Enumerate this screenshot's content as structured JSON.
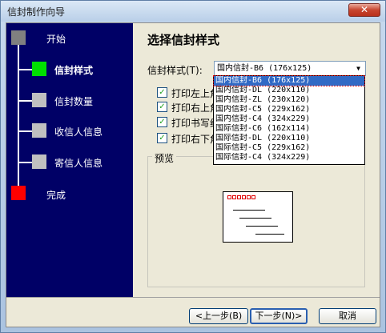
{
  "window": {
    "title": "信封制作向导",
    "close_label": "✕"
  },
  "colors": {
    "sidebar_bg": "#000066",
    "step_done": "#808080",
    "step_active": "#00e000",
    "step_pending": "#c0c0c0",
    "step_finish": "#ff0000",
    "selection": "#316ac5"
  },
  "sidebar": {
    "steps": [
      {
        "label": "开始",
        "state": "done"
      },
      {
        "label": "信封样式",
        "state": "active"
      },
      {
        "label": "信封数量",
        "state": "pending"
      },
      {
        "label": "收信人信息",
        "state": "pending"
      },
      {
        "label": "寄信人信息",
        "state": "pending"
      },
      {
        "label": "完成",
        "state": "finish"
      }
    ]
  },
  "main": {
    "heading": "选择信封样式",
    "style_label": "信封样式(T):",
    "style_value": "国内信封-B6 (176x125)",
    "options": [
      "国内信封-B6 (176x125)",
      "国内信封-DL (220x110)",
      "国内信封-ZL (230x120)",
      "国内信封-C5 (229x162)",
      "国内信封-C4 (324x229)",
      "国际信封-C6 (162x114)",
      "国际信封-DL (220x110)",
      "国际信封-C5 (229x162)",
      "国际信封-C4 (324x229)"
    ],
    "checkboxes": [
      {
        "label": "打印左上角",
        "checked": true
      },
      {
        "label": "打印右上角",
        "checked": true
      },
      {
        "label": "打印书写线",
        "checked": true
      },
      {
        "label": "打印右下角",
        "checked": true
      }
    ],
    "preview_label": "预览"
  },
  "footer": {
    "back_label": "<上一步(B)",
    "next_label": "下一步(N)>",
    "cancel_label": "取消"
  }
}
